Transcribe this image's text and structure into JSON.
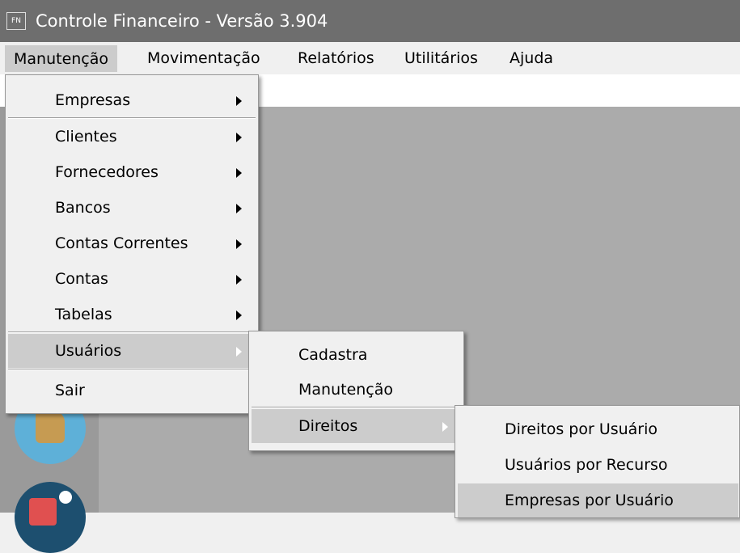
{
  "window": {
    "icon_text": "FN",
    "title": "Controle Financeiro - Versão 3.904"
  },
  "menubar": {
    "items": [
      "Manutenção",
      "Movimentação",
      "Relatórios",
      "Utilitários",
      "Ajuda"
    ]
  },
  "menu_manutencao": {
    "items": [
      "Empresas",
      "Clientes",
      "Fornecedores",
      "Bancos",
      "Contas Correntes",
      "Contas",
      "Tabelas",
      "Usuários",
      "Sair"
    ]
  },
  "menu_usuarios": {
    "items": [
      "Cadastra",
      "Manutenção",
      "Direitos"
    ]
  },
  "menu_direitos": {
    "items": [
      "Direitos por Usuário",
      "Usuários por Recurso",
      "Empresas por Usuário"
    ]
  },
  "colors": {
    "titlebar": "#6e6e6e",
    "menu_background": "#f0f0f0",
    "highlight": "#cccccc",
    "workspace": "#ababab"
  }
}
